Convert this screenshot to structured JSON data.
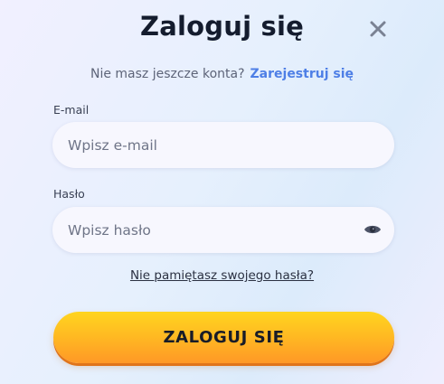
{
  "dialog": {
    "title": "Zaloguj się",
    "close_icon": "close-icon"
  },
  "signup": {
    "prompt": "Nie masz jeszcze konta?",
    "link": "Zarejestruj się",
    "link_color": "#4e7fe6"
  },
  "email": {
    "label": "E-mail",
    "placeholder": "Wpisz e-mail",
    "value": ""
  },
  "password": {
    "label": "Hasło",
    "placeholder": "Wpisz hasło",
    "value": "",
    "toggle_icon": "eye-icon"
  },
  "forgot_password": "Nie pamiętasz swojego hasła?",
  "submit": {
    "label": "ZALOGUJ SIĘ",
    "color_top": "#ffd51f",
    "color_bottom": "#ff9826"
  }
}
